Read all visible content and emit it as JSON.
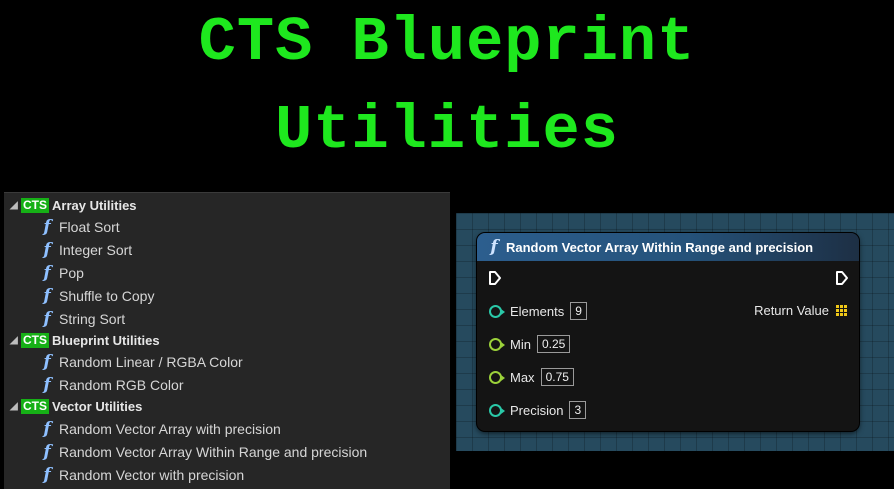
{
  "title": {
    "line1": "CTS Blueprint",
    "line2": "Utilities"
  },
  "colors": {
    "title": "#1ee81e",
    "badge": "#16b016",
    "int_pin": "#2ac8a8",
    "float_pin": "#9bd13a",
    "array_pin": "#f0c818"
  },
  "function_list": {
    "categories": [
      {
        "badge": "CTS",
        "label": "Array Utilities",
        "items": [
          "Float Sort",
          "Integer Sort",
          "Pop",
          "Shuffle to Copy",
          "String Sort"
        ]
      },
      {
        "badge": "CTS",
        "label": "Blueprint Utilities",
        "items": [
          "Random Linear / RGBA Color",
          "Random RGB Color"
        ]
      },
      {
        "badge": "CTS",
        "label": "Vector Utilities",
        "items": [
          "Random Vector Array with precision",
          "Random Vector Array Within Range and precision",
          "Random Vector with precision"
        ]
      }
    ],
    "function_icon": "f"
  },
  "node": {
    "icon": "f",
    "title": "Random Vector Array Within Range and precision",
    "inputs": [
      {
        "label": "Elements",
        "value": "9",
        "type": "integer"
      },
      {
        "label": "Min",
        "value": "0.25",
        "type": "float"
      },
      {
        "label": "Max",
        "value": "0.75",
        "type": "float"
      },
      {
        "label": "Precision",
        "value": "3",
        "type": "integer"
      }
    ],
    "output": {
      "label": "Return Value",
      "type": "vector-array"
    }
  }
}
